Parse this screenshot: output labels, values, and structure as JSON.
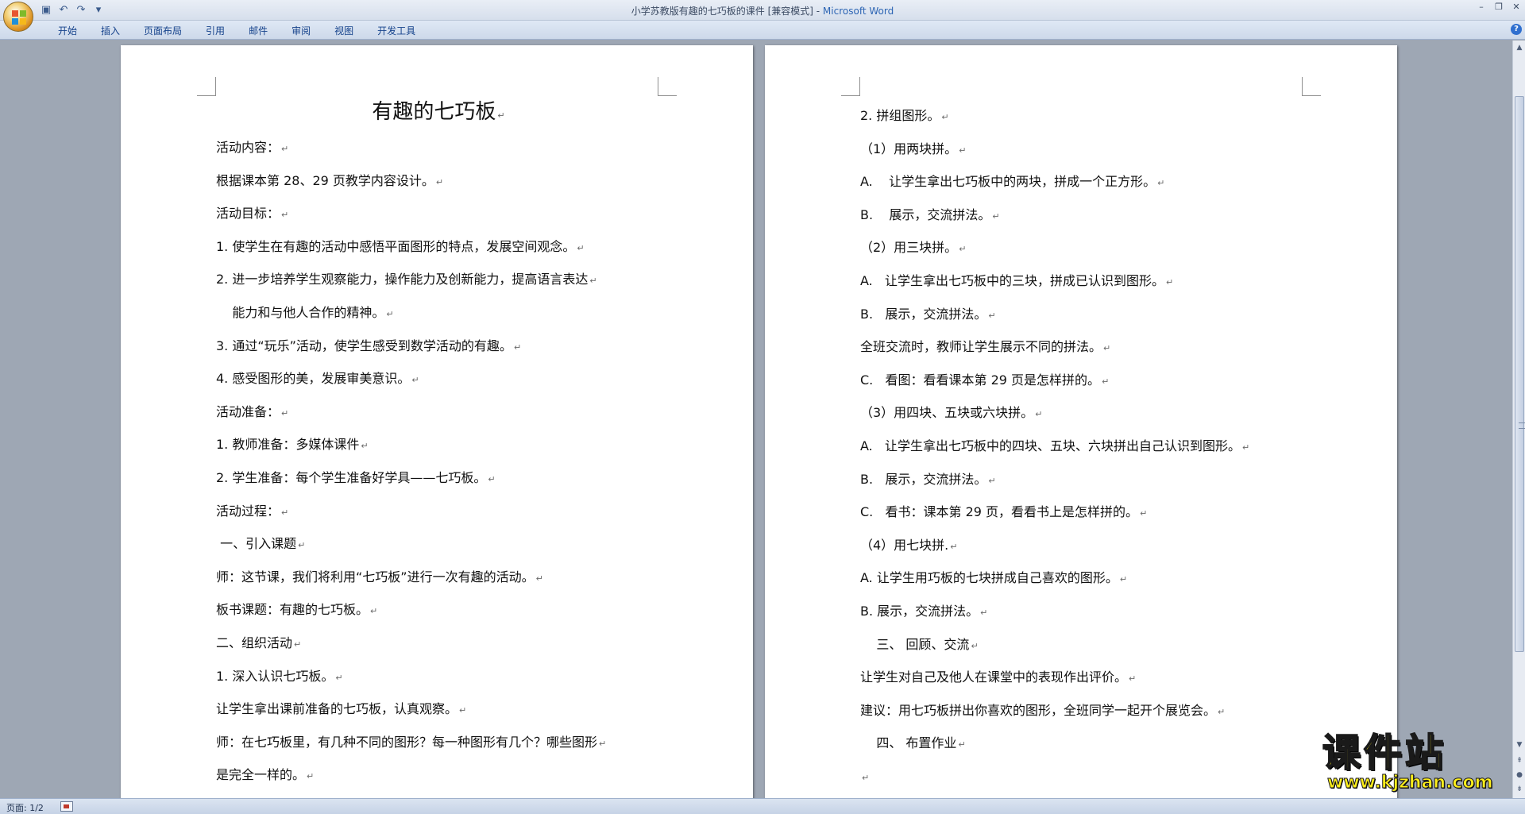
{
  "window": {
    "doc_title": "小学苏教版有趣的七巧板的课件 [兼容模式] - ",
    "app_name": "Microsoft Word"
  },
  "ribbon": {
    "tabs": [
      "开始",
      "插入",
      "页面布局",
      "引用",
      "邮件",
      "审阅",
      "视图",
      "开发工具"
    ]
  },
  "document": {
    "title": "有趣的七巧板",
    "left_lines": [
      "活动内容：",
      "根据课本第 28、29 页教学内容设计。",
      "活动目标：",
      "1. 使学生在有趣的活动中感悟平面图形的特点，发展空间观念。",
      "2. 进一步培养学生观察能力，操作能力及创新能力，提高语言表达",
      "    能力和与他人合作的精神。",
      "3. 通过“玩乐”活动，使学生感受到数学活动的有趣。",
      "4. 感受图形的美，发展审美意识。",
      "活动准备：",
      "1. 教师准备：多媒体课件",
      "2. 学生准备：每个学生准备好学具——七巧板。",
      "活动过程：",
      " 一、引入课题",
      "师：这节课，我们将利用“七巧板”进行一次有趣的活动。",
      "板书课题：有趣的七巧板。",
      "二、组织活动",
      "1. 深入认识七巧板。",
      "让学生拿出课前准备的七巧板，认真观察。",
      "师：在七巧板里，有几种不同的图形？每一种图形有几个？哪些图形",
      "是完全一样的。"
    ],
    "right_lines": [
      "2. 拼组图形。",
      "（1）用两块拼。",
      "A.    让学生拿出七巧板中的两块，拼成一个正方形。",
      "B.    展示，交流拼法。",
      "（2）用三块拼。",
      "A.   让学生拿出七巧板中的三块，拼成已认识到图形。",
      "B.   展示，交流拼法。",
      "全班交流时，教师让学生展示不同的拼法。",
      "C.   看图：看看课本第 29 页是怎样拼的。",
      "（3）用四块、五块或六块拼。",
      "A.   让学生拿出七巧板中的四块、五块、六块拼出自己认识到图形。",
      "B.   展示，交流拼法。",
      "C.   看书：课本第 29 页，看看书上是怎样拼的。",
      "（4）用七块拼.",
      "A. 让学生用巧板的七块拼成自己喜欢的图形。",
      "B. 展示，交流拼法。",
      "    三、 回顾、交流",
      "让学生对自己及他人在课堂中的表现作出评价。",
      "建议：用七巧板拼出你喜欢的图形，全班同学一起开个展览会。",
      "    四、 布置作业",
      ""
    ]
  },
  "status": {
    "page_indicator": "页面: 1/2"
  },
  "watermark": {
    "title": "课件站",
    "url": "www.kjzhan.com"
  }
}
